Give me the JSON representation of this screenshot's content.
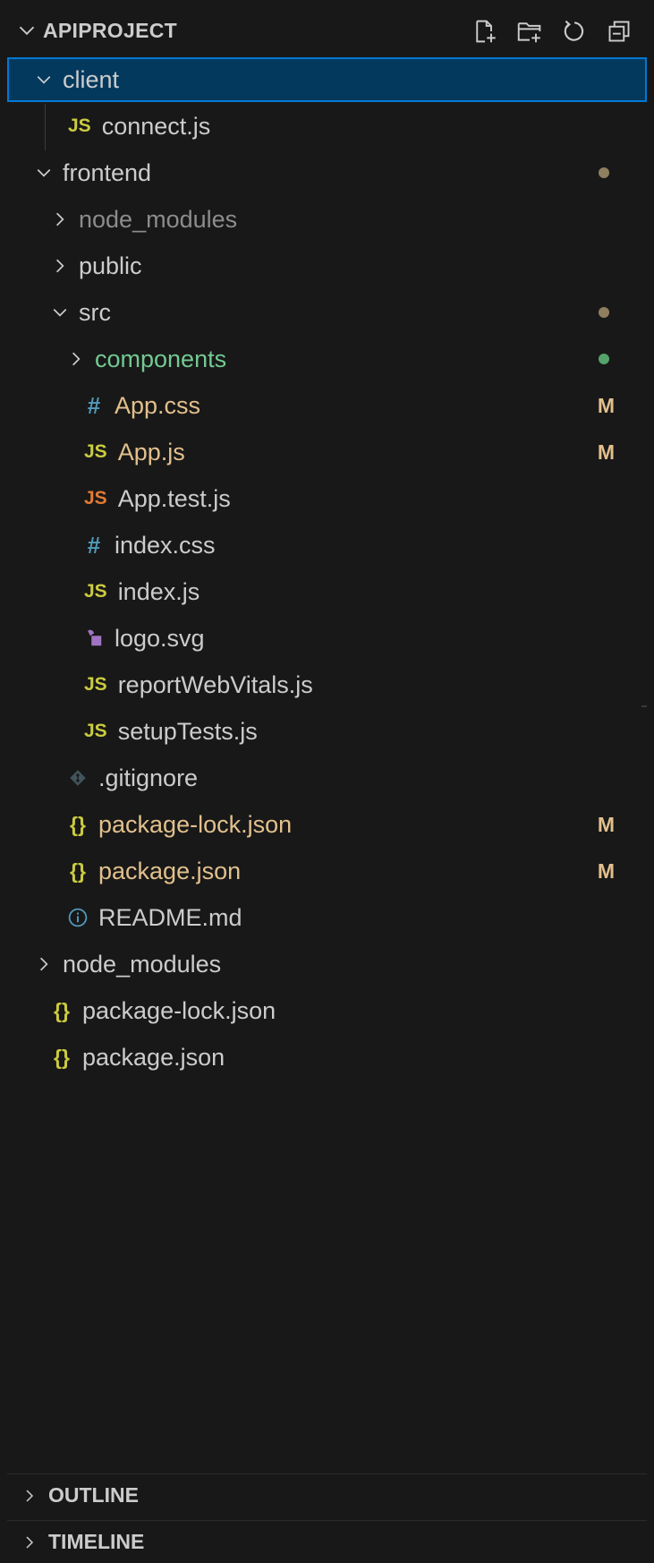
{
  "explorer": {
    "title": "APIPROJECT",
    "actions": [
      "new-file-icon",
      "new-folder-icon",
      "refresh-icon",
      "collapse-all-icon"
    ]
  },
  "colors": {
    "selected_bg": "#04395e",
    "selected_border": "#0078d4",
    "modified": "#e2c08d",
    "untracked": "#73c991",
    "ignored": "#8c8c8c",
    "modified_dot": "#8f7f5f",
    "untracked_dot": "#54a36b"
  },
  "tree": [
    {
      "label": "client",
      "type": "folder",
      "expanded": true,
      "depth": 0,
      "selected": true
    },
    {
      "label": "connect.js",
      "type": "js",
      "icon_text": "JS",
      "depth": 1
    },
    {
      "label": "frontend",
      "type": "folder",
      "expanded": true,
      "depth": 0,
      "dot": "modified"
    },
    {
      "label": "node_modules",
      "type": "folder",
      "expanded": false,
      "depth": 1,
      "state": "ignored"
    },
    {
      "label": "public",
      "type": "folder",
      "expanded": false,
      "depth": 1
    },
    {
      "label": "src",
      "type": "folder",
      "expanded": true,
      "depth": 1,
      "dot": "modified"
    },
    {
      "label": "components",
      "type": "folder",
      "expanded": false,
      "depth": 2,
      "state": "untracked",
      "dot": "untracked"
    },
    {
      "label": "App.css",
      "type": "css",
      "icon_text": "#",
      "depth": 2,
      "state": "modified",
      "badge": "M"
    },
    {
      "label": "App.js",
      "type": "js",
      "icon_text": "JS",
      "depth": 2,
      "state": "modified",
      "badge": "M"
    },
    {
      "label": "App.test.js",
      "type": "jstest",
      "icon_text": "JS",
      "depth": 2
    },
    {
      "label": "index.css",
      "type": "css",
      "icon_text": "#",
      "depth": 2
    },
    {
      "label": "index.js",
      "type": "js",
      "icon_text": "JS",
      "depth": 2
    },
    {
      "label": "logo.svg",
      "type": "svg",
      "depth": 2
    },
    {
      "label": "reportWebVitals.js",
      "type": "js",
      "icon_text": "JS",
      "depth": 2
    },
    {
      "label": "setupTests.js",
      "type": "js",
      "icon_text": "JS",
      "depth": 2
    },
    {
      "label": ".gitignore",
      "type": "git",
      "depth": 1
    },
    {
      "label": "package-lock.json",
      "type": "json",
      "icon_text": "{}",
      "depth": 1,
      "state": "modified",
      "badge": "M"
    },
    {
      "label": "package.json",
      "type": "json",
      "icon_text": "{}",
      "depth": 1,
      "state": "modified",
      "badge": "M"
    },
    {
      "label": "README.md",
      "type": "info",
      "icon_text": "ⓘ",
      "depth": 1
    },
    {
      "label": "node_modules",
      "type": "folder",
      "expanded": false,
      "depth": 0
    },
    {
      "label": "package-lock.json",
      "type": "json",
      "icon_text": "{}",
      "depth": 0
    },
    {
      "label": "package.json",
      "type": "json",
      "icon_text": "{}",
      "depth": 0
    }
  ],
  "sections": [
    {
      "label": "OUTLINE"
    },
    {
      "label": "TIMELINE"
    }
  ]
}
